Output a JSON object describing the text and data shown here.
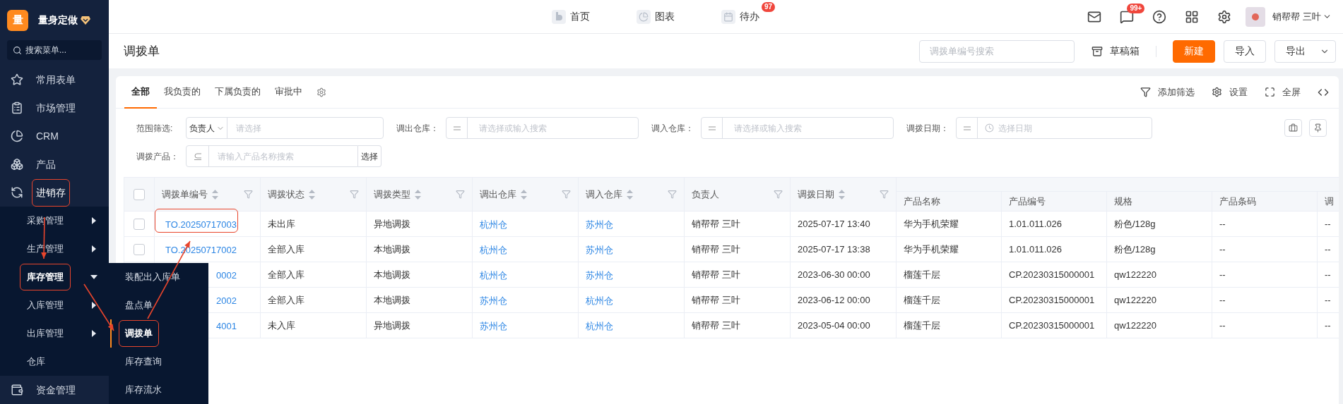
{
  "sidebar": {
    "brand": {
      "logo": "量",
      "name": "量身定做"
    },
    "search": {
      "placeholder": "搜索菜单..."
    },
    "items": [
      {
        "label": "常用表单",
        "expanded": false
      },
      {
        "label": "市场管理",
        "expanded": false
      },
      {
        "label": "CRM",
        "expanded": false
      },
      {
        "label": "产品",
        "expanded": false
      },
      {
        "label": "进销存",
        "expanded": true,
        "children": [
          {
            "label": "采购管理",
            "kind": "group",
            "expanded": false
          },
          {
            "label": "生产管理",
            "kind": "group",
            "expanded": false
          },
          {
            "label": "库存管理",
            "kind": "group",
            "expanded": true,
            "children": [
              {
                "label": "装配出入库单",
                "selected": false
              },
              {
                "label": "盘点单",
                "selected": false
              },
              {
                "label": "调拨单",
                "selected": true
              },
              {
                "label": "库存查询",
                "selected": false
              },
              {
                "label": "库存流水",
                "selected": false
              }
            ]
          },
          {
            "label": "入库管理",
            "kind": "group",
            "expanded": false
          },
          {
            "label": "出库管理",
            "kind": "group",
            "expanded": false
          },
          {
            "label": "仓库",
            "kind": "link"
          }
        ]
      },
      {
        "label": "资金管理",
        "expanded": false
      }
    ]
  },
  "top_nav": [
    {
      "label": "首页"
    },
    {
      "label": "图表"
    },
    {
      "label": "待办",
      "badge": "97"
    }
  ],
  "header": {
    "chat_badge": "99+",
    "user": "销帮帮 三叶"
  },
  "page": {
    "title": "调拨单",
    "search": {
      "placeholder": "调拨单编号搜索"
    },
    "drafts": "草稿箱",
    "buttons": [
      {
        "label": "新建",
        "kind": "primary"
      },
      {
        "label": "导入",
        "kind": "default"
      },
      {
        "label": "导出",
        "kind": "dropdown"
      }
    ]
  },
  "tabs": [
    {
      "label": "全部",
      "selected": true
    },
    {
      "label": "我负责的",
      "selected": false
    },
    {
      "label": "下属负责的",
      "selected": false
    },
    {
      "label": "审批中",
      "selected": false
    }
  ],
  "toolbar": [
    "添加筛选",
    "设置",
    "全屏"
  ],
  "filters": [
    {
      "label": "范围筛选:",
      "kind": "scope",
      "select": "负责人",
      "placeholder": "请选择"
    },
    {
      "label": "调出仓库：",
      "kind": "equals",
      "placeholder": "请选择或输入搜索"
    },
    {
      "label": "调入仓库：",
      "kind": "equals",
      "placeholder": "请选择或输入搜索"
    },
    {
      "label": "调拨日期：",
      "kind": "date",
      "placeholder": "选择日期"
    },
    {
      "label": "调拨产品：",
      "kind": "product",
      "placeholder": "请输入产品名称搜索",
      "button": "选择"
    }
  ],
  "table": {
    "all_checked": false,
    "columns": [
      {
        "label": "调拨单编号",
        "kind": "link",
        "sortable": true,
        "filterable": true
      },
      {
        "label": "调拨状态",
        "kind": "text",
        "sortable": true,
        "filterable": true
      },
      {
        "label": "调拨类型",
        "kind": "text",
        "sortable": true,
        "filterable": true
      },
      {
        "label": "调出仓库",
        "kind": "link",
        "sortable": true,
        "filterable": true
      },
      {
        "label": "调入仓库",
        "kind": "link",
        "sortable": true,
        "filterable": true
      },
      {
        "label": "负责人",
        "kind": "text",
        "sortable": false,
        "filterable": true
      },
      {
        "label": "调拨日期",
        "kind": "text",
        "sortable": true,
        "filterable": true
      }
    ],
    "product_columns": [
      "产品名称",
      "产品编号",
      "规格",
      "产品条码",
      "调"
    ],
    "rows": [
      {
        "checked": false,
        "annotated": true,
        "cells": [
          "TO.20250717003",
          "未出库",
          "异地调拨",
          "杭州仓",
          "苏州仓",
          "销帮帮 三叶",
          "2025-07-17 13:40",
          "华为手机荣耀",
          "1.01.011.026",
          "粉色/128g",
          "--",
          "--"
        ]
      },
      {
        "checked": false,
        "annotated": false,
        "cells": [
          "TO.20250717002",
          "全部入库",
          "本地调拨",
          "杭州仓",
          "苏州仓",
          "销帮帮 三叶",
          "2025-07-17 13:38",
          "华为手机荣耀",
          "1.01.011.026",
          "粉色/128g",
          "--",
          "--"
        ]
      },
      {
        "annotated": false,
        "cells": [
          "0002",
          "全部入库",
          "本地调拨",
          "杭州仓",
          "苏州仓",
          "销帮帮 三叶",
          "2023-06-30 00:00",
          "榴莲千层",
          "CP.20230315000001",
          "qw122220",
          "--",
          "--"
        ]
      },
      {
        "annotated": false,
        "cells": [
          "2002",
          "全部入库",
          "本地调拨",
          "苏州仓",
          "杭州仓",
          "销帮帮 三叶",
          "2023-06-12 00:00",
          "榴莲千层",
          "CP.20230315000001",
          "qw122220",
          "--",
          "--"
        ]
      },
      {
        "annotated": false,
        "cells": [
          "4001",
          "未入库",
          "异地调拨",
          "苏州仓",
          "杭州仓",
          "销帮帮 三叶",
          "2023-05-04 00:00",
          "榴莲千层",
          "CP.20230315000001",
          "qw122220",
          "--",
          "--"
        ]
      }
    ]
  }
}
